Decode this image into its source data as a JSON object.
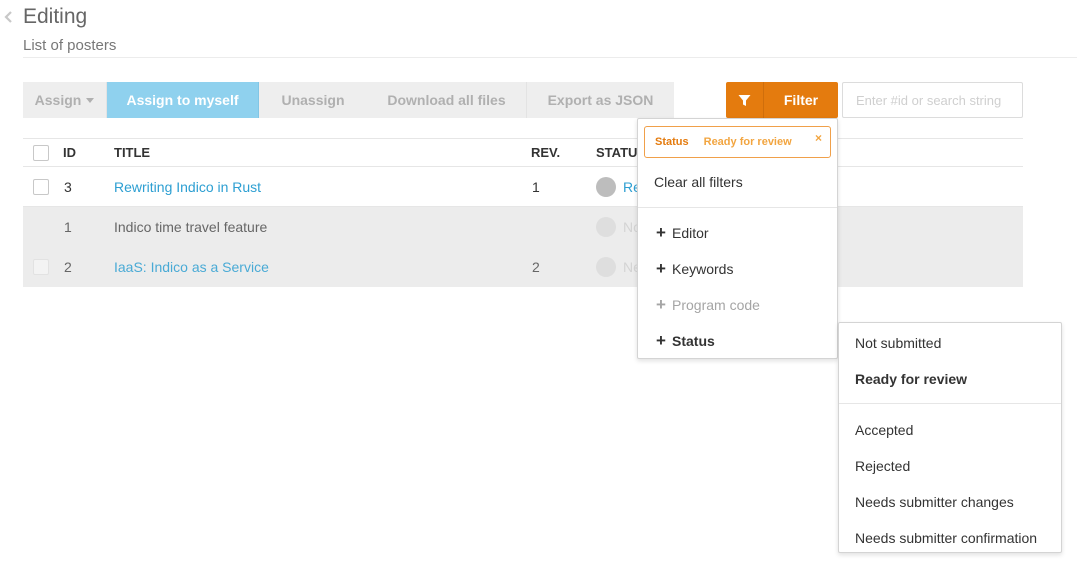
{
  "header": {
    "title": "Editing",
    "subtitle": "List of posters"
  },
  "toolbar": {
    "assign": "Assign",
    "assign_to_myself": "Assign to myself",
    "unassign": "Unassign",
    "download_all": "Download all files",
    "export_json": "Export as JSON",
    "filter": "Filter"
  },
  "search": {
    "placeholder": "Enter #id or search string"
  },
  "table": {
    "columns": {
      "id": "ID",
      "title": "TITLE",
      "rev": "REV.",
      "status": "STATU"
    },
    "rows": [
      {
        "id": "3",
        "title": "Rewriting Indico in Rust",
        "rev": "1",
        "status": "Re"
      },
      {
        "id": "1",
        "title": "Indico time travel feature",
        "rev": "",
        "status": "No"
      },
      {
        "id": "2",
        "title": "IaaS: Indico as a Service",
        "rev": "2",
        "status": "Ne"
      }
    ]
  },
  "filter_menu": {
    "active_filter": {
      "key": "Status",
      "value": "Ready for review",
      "close": "×"
    },
    "clear_all": "Clear all filters",
    "items": [
      "Editor",
      "Keywords",
      "Program code",
      "Status"
    ]
  },
  "status_menu": {
    "options": [
      "Not submitted",
      "Ready for review",
      "Accepted",
      "Rejected",
      "Needs submitter changes",
      "Needs submitter confirmation"
    ]
  },
  "colors": {
    "accent": "#e47b0e",
    "primary_button": "#8fd1ee",
    "link": "#2d9fd2"
  },
  "icons": {
    "back": "chevron-left-icon",
    "filter": "funnel-icon",
    "add": "plus-icon",
    "close": "close-icon"
  }
}
